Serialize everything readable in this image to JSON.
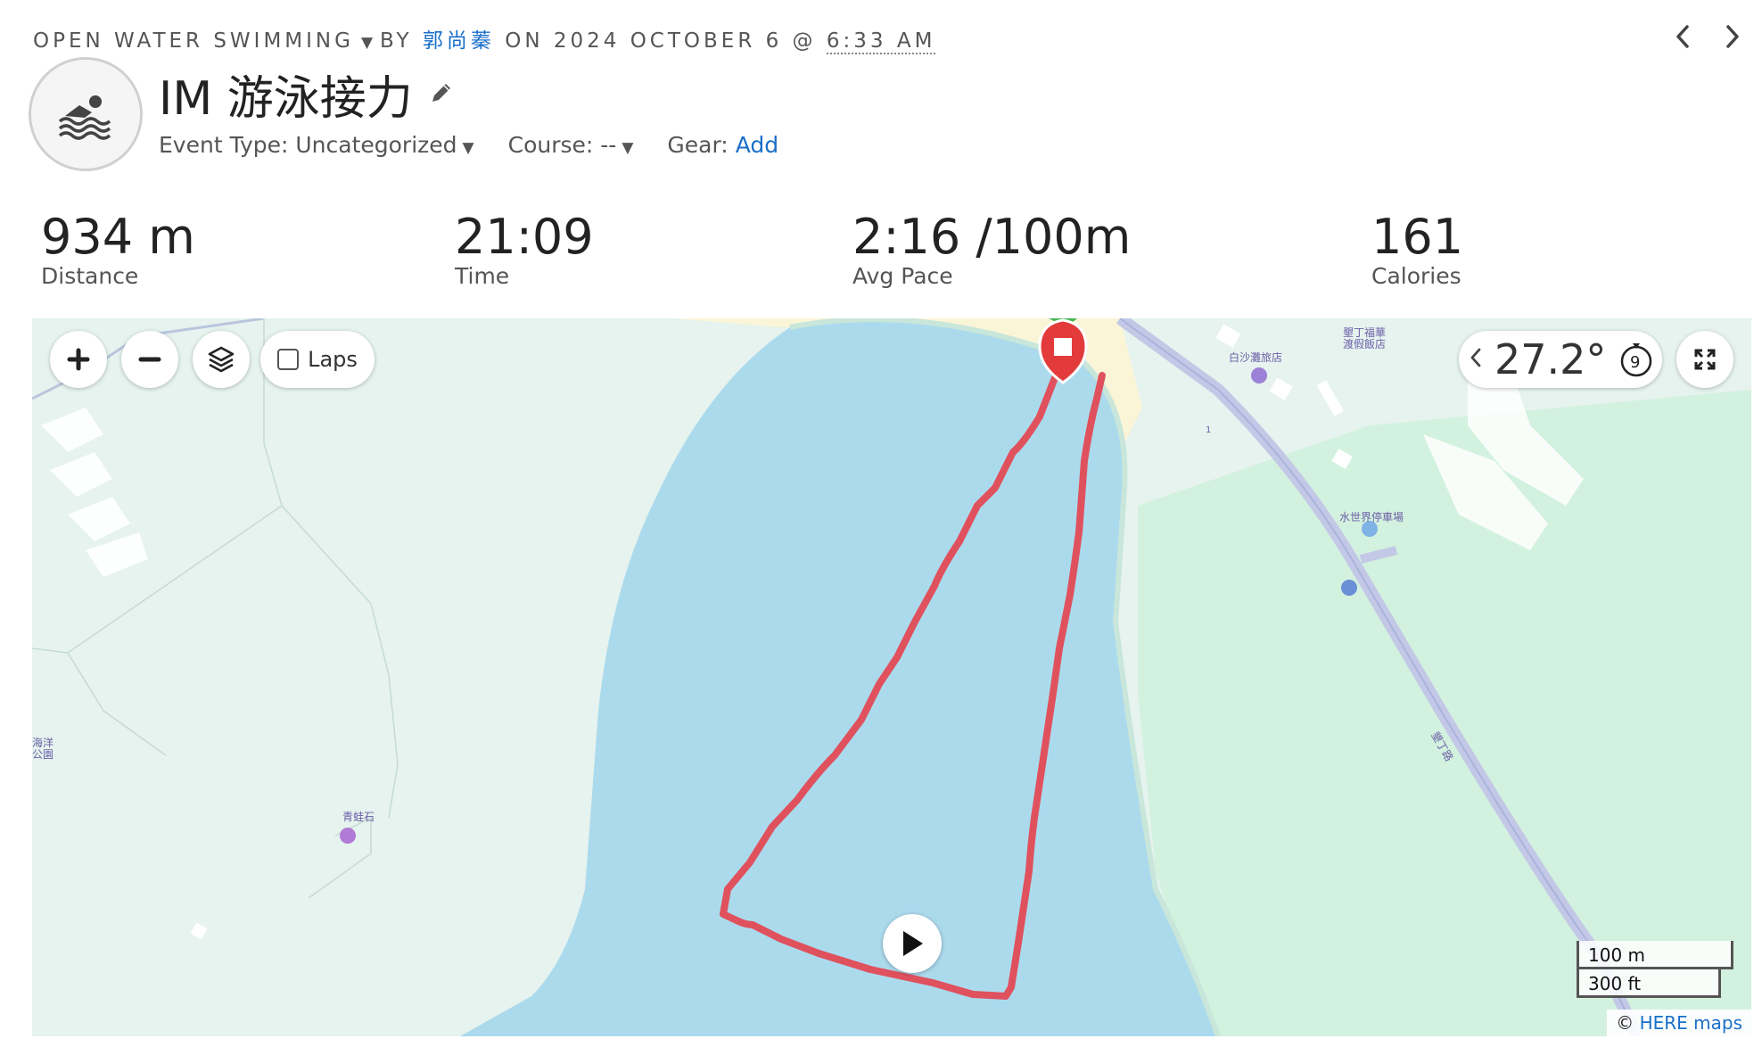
{
  "header": {
    "activity_type": "OPEN WATER SWIMMING",
    "by_label": "BY",
    "author": "郭尚蓁",
    "on_label": "ON 2024 OCTOBER 6 @",
    "time": "6:33 AM"
  },
  "activity": {
    "title": "IM 游泳接力",
    "event_type_label": "Event Type:",
    "event_type_value": "Uncategorized",
    "course_label": "Course:",
    "course_value": "--",
    "gear_label": "Gear:",
    "gear_action": "Add"
  },
  "stats": [
    {
      "value": "934 m",
      "label": "Distance"
    },
    {
      "value": "21:09",
      "label": "Time"
    },
    {
      "value": "2:16 /100m",
      "label": "Avg Pace"
    },
    {
      "value": "161",
      "label": "Calories"
    }
  ],
  "map": {
    "laps_label": "Laps",
    "laps_checked": false,
    "temperature": "27.2°",
    "timer_badge": "9",
    "scale_metric": "100 m",
    "scale_imperial": "300 ft",
    "attribution_prefix": "©",
    "attribution_link": "HERE maps",
    "labels": {
      "hotel_top": "墾丁福華\n渡假飯店",
      "hotel_top_line1": "墾丁福華",
      "hotel_top_line2": "渡假飯店",
      "bai_sha": "白沙灘旅店",
      "water_world": "水世界停車場",
      "road": "墾丁路",
      "frog_rock": "青蛙石",
      "ocean_1": "海洋",
      "ocean_2": "公園",
      "one": "1"
    },
    "route_color": "#e0515e",
    "water_color": "#acdaed",
    "land_color": "#e6f3ee"
  }
}
